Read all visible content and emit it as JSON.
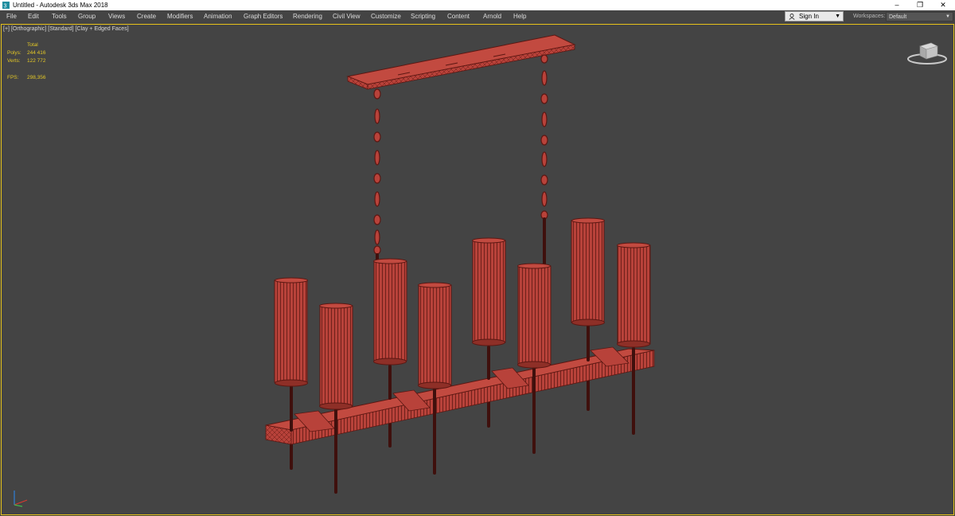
{
  "window": {
    "title": "Untitled - Autodesk 3ds Max 2018",
    "controls": {
      "minimize": "–",
      "restore": "❐",
      "close": "✕"
    }
  },
  "menu": {
    "items": [
      "File",
      "Edit",
      "Tools",
      "Group",
      "Views",
      "Create",
      "Modifiers",
      "Animation",
      "Graph Editors",
      "Rendering",
      "Civil View",
      "Customize",
      "Scripting",
      "Content",
      "Arnold",
      "Help"
    ]
  },
  "account": {
    "sign_in_label": "Sign In"
  },
  "workspaces": {
    "label": "Workspaces:",
    "selected": "Default"
  },
  "viewport": {
    "labels": {
      "plus": "[+]",
      "view": "[Orthographic]",
      "shading": "[Standard]",
      "style": "[Clay + Edged Faces]"
    },
    "stats": {
      "total_label": "Total",
      "polys_label": "Polys:",
      "polys_value": "244 416",
      "verts_label": "Verts:",
      "verts_value": "122 772",
      "fps_label": "FPS:",
      "fps_value": "298,356"
    },
    "colors": {
      "active_border": "#e7c21a",
      "background": "#444444",
      "mesh_fill": "#b8423a",
      "mesh_wire": "#5c1712"
    }
  },
  "icons": {
    "app": "3ds-max-logo-icon",
    "user": "user-icon",
    "viewcube": "viewcube-icon",
    "axis": "axis-tripod-icon"
  }
}
